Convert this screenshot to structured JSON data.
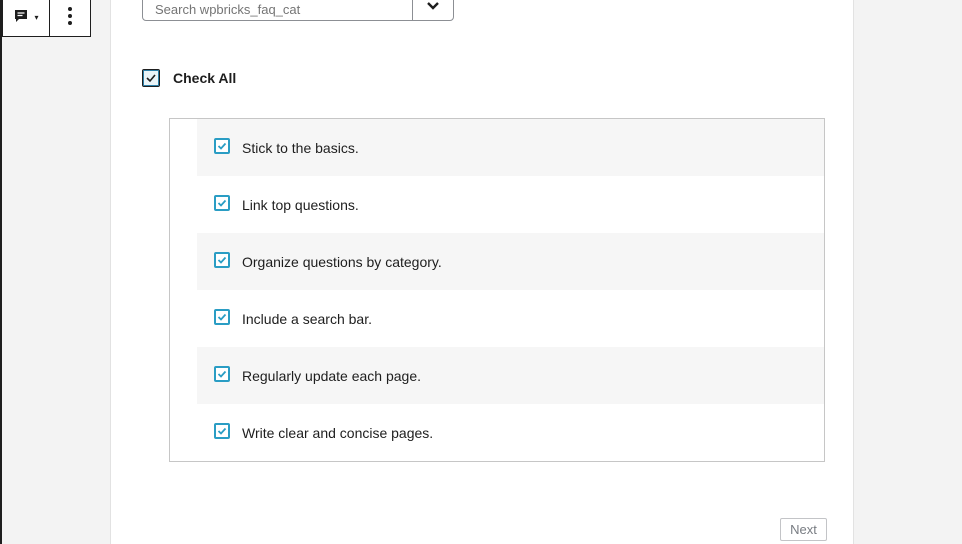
{
  "toolbar": {
    "block_icon": "comment-icon",
    "more_icon": "more-vertical-icon"
  },
  "search": {
    "placeholder": "Search wpbricks_faq_cat"
  },
  "check_all": {
    "label": "Check All",
    "checked": true
  },
  "items": [
    {
      "label": "Stick to the basics.",
      "checked": true
    },
    {
      "label": "Link top questions.",
      "checked": true
    },
    {
      "label": "Organize questions by category.",
      "checked": true
    },
    {
      "label": "Include a search bar.",
      "checked": true
    },
    {
      "label": "Regularly update each page.",
      "checked": true
    },
    {
      "label": "Write clear and concise pages.",
      "checked": true
    }
  ],
  "pagination": {
    "next_label": "Next"
  },
  "colors": {
    "accent": "#2a9dc4"
  }
}
